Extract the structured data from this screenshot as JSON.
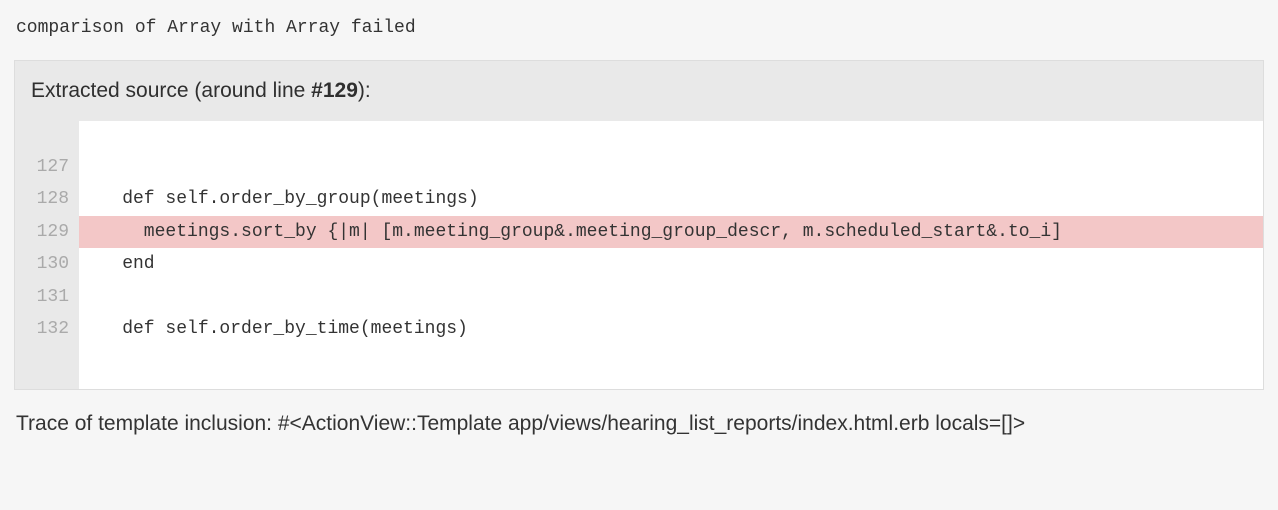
{
  "error_message": "comparison of Array with Array failed",
  "source_header": {
    "prefix": "Extracted source (around line ",
    "line_label": "#129",
    "suffix": "):"
  },
  "highlighted_line": 129,
  "lines": [
    {
      "num": "127",
      "content": ""
    },
    {
      "num": "128",
      "content": "    def self.order_by_group(meetings)"
    },
    {
      "num": "129",
      "content": "      meetings.sort_by {|m| [m.meeting_group&.meeting_group_descr, m.scheduled_start&.to_i]"
    },
    {
      "num": "130",
      "content": "    end"
    },
    {
      "num": "131",
      "content": ""
    },
    {
      "num": "132",
      "content": "    def self.order_by_time(meetings)"
    }
  ],
  "trace": "Trace of template inclusion: #<ActionView::Template app/views/hearing_list_reports/index.html.erb locals=[]>"
}
